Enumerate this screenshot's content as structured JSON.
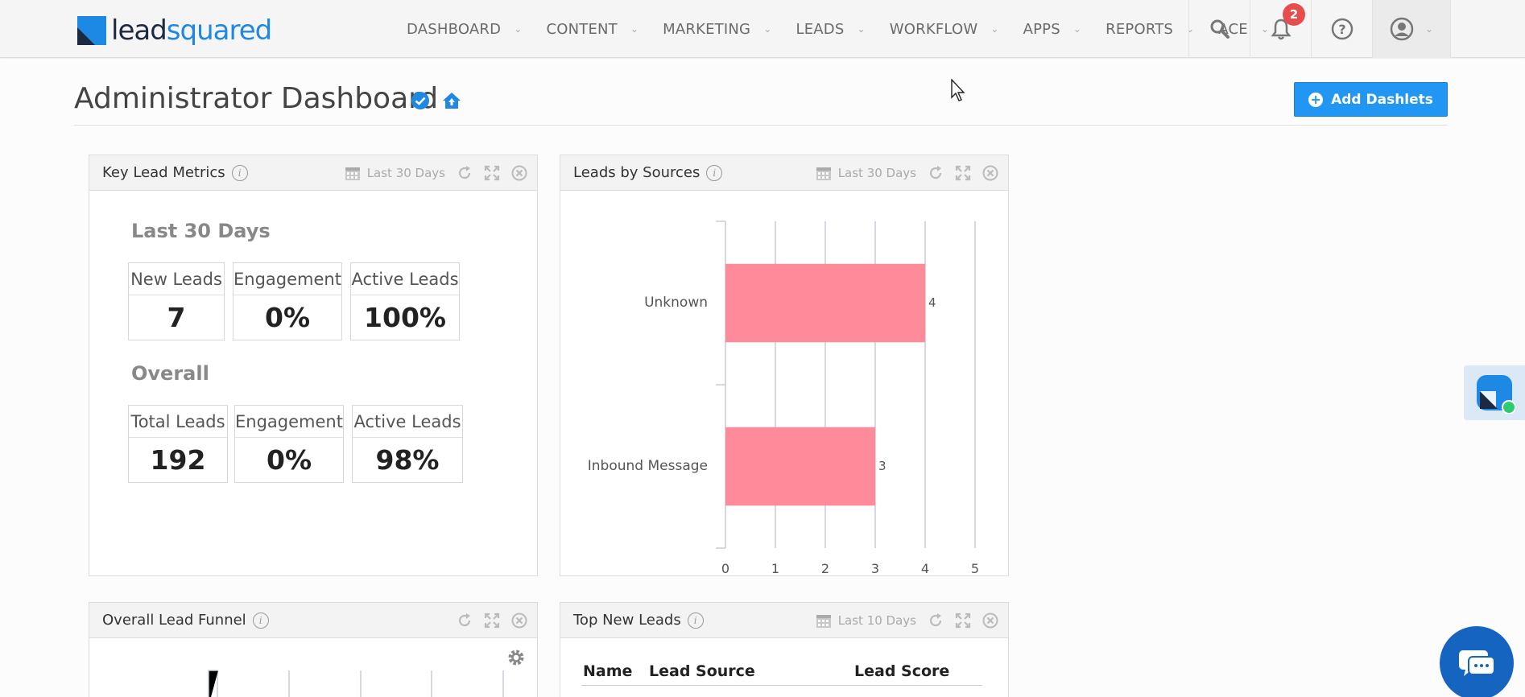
{
  "brand": {
    "lead": "lead",
    "squared": "squared"
  },
  "nav": {
    "items": [
      {
        "label": "DASHBOARD"
      },
      {
        "label": "CONTENT"
      },
      {
        "label": "MARKETING"
      },
      {
        "label": "LEADS"
      },
      {
        "label": "WORKFLOW"
      },
      {
        "label": "APPS"
      },
      {
        "label": "REPORTS"
      },
      {
        "label": "ACE"
      }
    ],
    "notification_count": "2"
  },
  "page": {
    "title": "Administrator Dashboard",
    "add_button": "Add Dashlets"
  },
  "key_metrics": {
    "title": "Key Lead Metrics",
    "range": "Last 30 Days",
    "period_label": "Last 30 Days",
    "period_metrics": [
      {
        "label": "New Leads",
        "value": "7"
      },
      {
        "label": "Engagement",
        "value": "0%"
      },
      {
        "label": "Active Leads",
        "value": "100%"
      }
    ],
    "overall_label": "Overall",
    "overall_metrics": [
      {
        "label": "Total Leads",
        "value": "192"
      },
      {
        "label": "Engagement",
        "value": "0%"
      },
      {
        "label": "Active Leads",
        "value": "98%"
      }
    ]
  },
  "leads_by_sources": {
    "title": "Leads by Sources",
    "range": "Last 30 Days"
  },
  "chart_data": {
    "type": "bar",
    "orientation": "horizontal",
    "categories": [
      "Unknown",
      "Inbound Message"
    ],
    "values": [
      4,
      3
    ],
    "xlim": [
      0,
      5
    ],
    "xticks": [
      "0",
      "1",
      "2",
      "3",
      "4",
      "5"
    ],
    "bar_color": "#ff8a9a",
    "grid": true
  },
  "funnel": {
    "title": "Overall Lead Funnel"
  },
  "top_new_leads": {
    "title": "Top New Leads",
    "range": "Last 10 Days",
    "columns": [
      "Name",
      "Lead Source",
      "Lead Score"
    ]
  },
  "colors": {
    "accent": "#2196f3",
    "badge": "#e84d4d",
    "chat": "#1565c0"
  }
}
